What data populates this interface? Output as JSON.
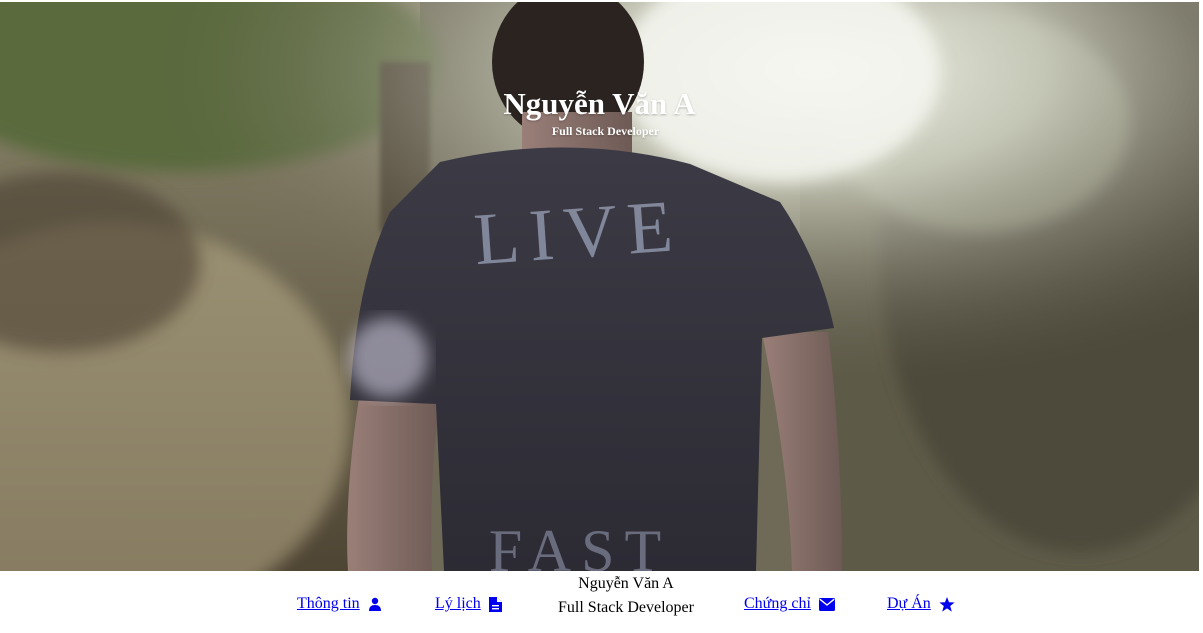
{
  "hero": {
    "name": "Nguyễn Văn A",
    "role": "Full Stack Developer",
    "background_image": "man-in-tshirt-walking-in-sunlit-forest",
    "tshirt_print": "LIVE FAST"
  },
  "nav": {
    "brand_name": "Nguyễn Văn A",
    "brand_role": "Full Stack Developer",
    "items": [
      {
        "label": "Thông tin",
        "icon": "user-icon"
      },
      {
        "label": "Lý lịch",
        "icon": "file-icon"
      },
      {
        "label": "Chứng chỉ",
        "icon": "envelope-icon"
      },
      {
        "label": "Dự Án",
        "icon": "star-icon"
      }
    ]
  },
  "colors": {
    "link": "#0000ee",
    "hero_text": "#ffffff",
    "nav_bg": "#ffffff"
  }
}
